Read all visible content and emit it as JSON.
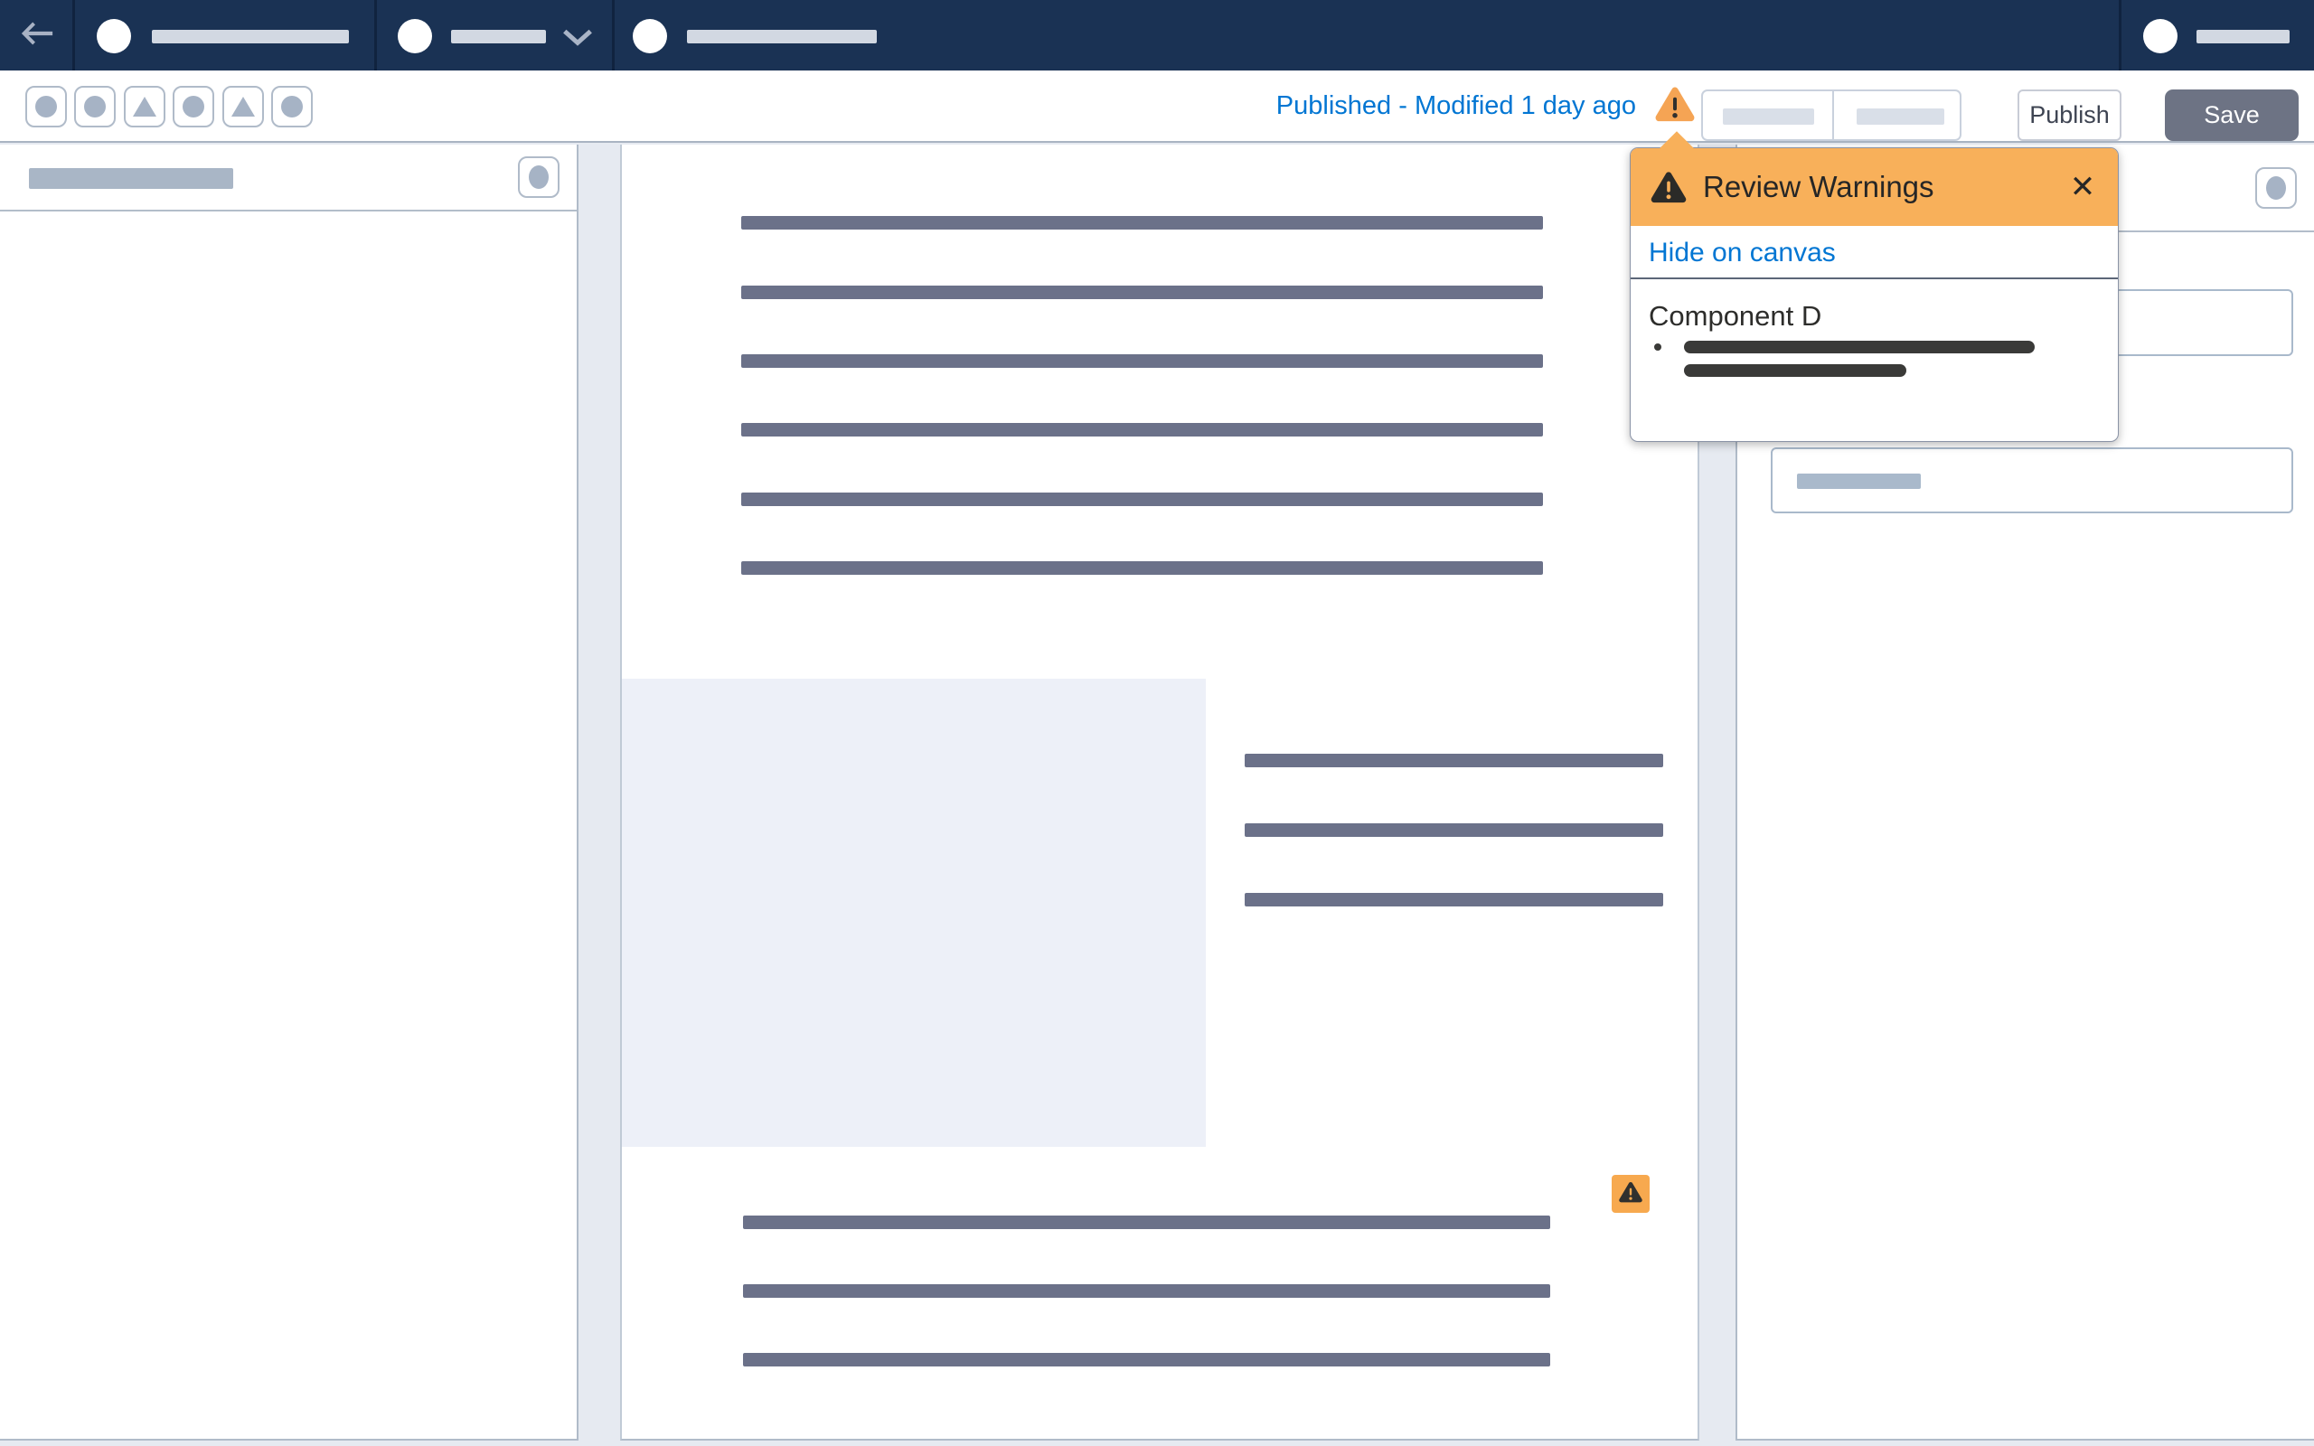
{
  "topbar": {
    "back_tooltip": "Back",
    "sections": [
      {
        "type": "app",
        "icon": "avatar-circle",
        "label_placeholder": true
      },
      {
        "type": "context-dropdown",
        "icon": "avatar-circle",
        "label_placeholder": true,
        "chevron": true
      },
      {
        "type": "context",
        "icon": "avatar-circle",
        "label_placeholder": true
      },
      {
        "type": "user",
        "icon": "avatar-circle",
        "label_placeholder": true
      }
    ]
  },
  "toolbar": {
    "status_text": "Published - Modified 1 day ago",
    "publish_label": "Publish",
    "save_label": "Save",
    "icon_buttons": [
      "circle",
      "circle",
      "triangle",
      "circle",
      "triangle",
      "circle"
    ],
    "warning_icon": "warning-triangle",
    "disabled_segments": 2
  },
  "popover": {
    "title": "Review Warnings",
    "close_glyph": "✕",
    "hide_link": "Hide on canvas",
    "component_title": "Component D",
    "bullet_lines": 2
  },
  "canvas": {
    "paragraph1_lines": 6,
    "image_placeholder": true,
    "side_lines": 3,
    "warning_badge": "warning-triangle",
    "paragraph2_lines": 3
  },
  "panels": {
    "left_header_placeholder": true,
    "right_inputs": 2
  },
  "colors": {
    "topbar_navy": "#1a3254",
    "link_blue": "#0176d3",
    "popover_header_orange": "#f8b05a",
    "badge_orange": "#f7a94f",
    "save_button_gray": "#6d7384",
    "canvas_text_line": "#6b7189",
    "popover_redacted_line": "#3a3a38",
    "placeholder_gray": "#a9b6c6",
    "image_placeholder_bg": "#edf0f8"
  }
}
